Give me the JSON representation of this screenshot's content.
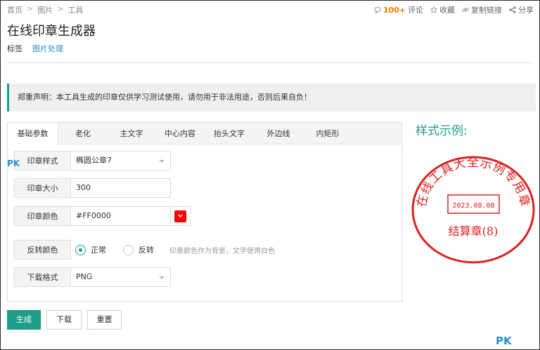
{
  "breadcrumb": {
    "home": "首页",
    "images": "图片",
    "tools": "工具",
    "sep": ">"
  },
  "actions": {
    "count": "100+",
    "comment": "评论",
    "favorite": "收藏",
    "copy_link": "复制链接",
    "share": "分享"
  },
  "page_title": "在线印章生成器",
  "tags": {
    "label": "标签",
    "link": "图片处理"
  },
  "notice": "郑重声明：本工具生成的印章仅供学习测试使用，请勿用于非法用途，否则后果自负！",
  "tabs": [
    "基础参数",
    "老化",
    "主文字",
    "中心内容",
    "抬头文字",
    "外边线",
    "内矩形"
  ],
  "form": {
    "style_label": "印章样式",
    "style_value": "椭圆公章7",
    "size_label": "印章大小",
    "size_value": "300",
    "color_label": "印章颜色",
    "color_value": "#FF0000",
    "invert_label": "反转颜色",
    "invert_normal": "正常",
    "invert_reverse": "反转",
    "invert_hint": "印章颜色作为背景，文字使用白色",
    "format_label": "下载格式",
    "format_value": "PNG"
  },
  "buttons": {
    "generate": "生成",
    "download": "下载",
    "reset": "重置"
  },
  "sample": {
    "title": "样式示例:",
    "arc_text": "在线工具大全示例专用章",
    "date": "2023.08.08",
    "center_text": "结算章(8)",
    "color": "#e02020"
  },
  "watermark": {
    "left": "PK",
    "right": "PK"
  },
  "colors": {
    "accent": "#1e9e88",
    "link": "#2a8fc9",
    "stamp": "#ff0000"
  }
}
